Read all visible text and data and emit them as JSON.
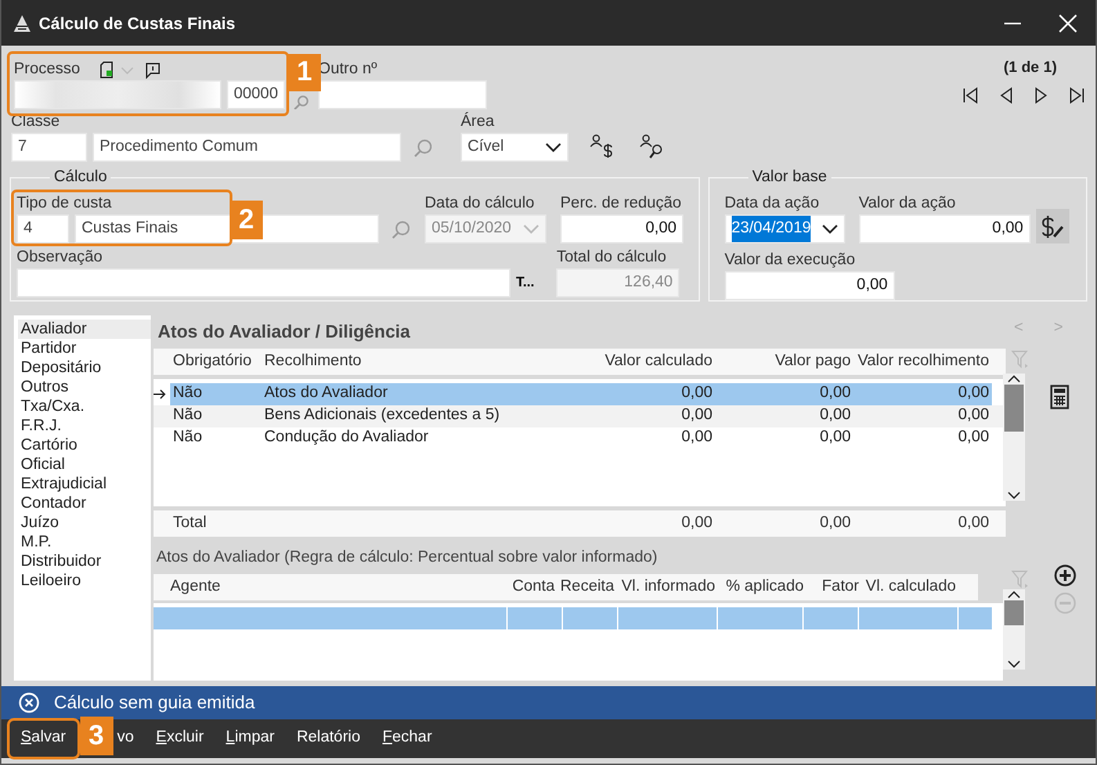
{
  "window": {
    "title": "Cálculo de Custas Finais"
  },
  "processo": {
    "label": "Processo",
    "number": "00000",
    "callout": "1"
  },
  "outro_numero": {
    "label": "Outro nº"
  },
  "pager": {
    "text": "(1 de 1)"
  },
  "classe": {
    "label": "Classe",
    "code": "7",
    "name": "Procedimento Comum"
  },
  "area": {
    "label": "Área",
    "value": "Cível"
  },
  "calculo": {
    "legend": "Cálculo",
    "tipo_custa": {
      "label": "Tipo de custa",
      "code": "4",
      "name": "Custas Finais",
      "callout": "2"
    },
    "data_calculo": {
      "label": "Data do cálculo",
      "value": "05/10/2020",
      "disabled": true
    },
    "perc_reducao": {
      "label": "Perc. de redução",
      "value": "0,00",
      "disabled": false
    },
    "observacao": {
      "label": "Observação",
      "button": "T..."
    },
    "total": {
      "label": "Total do cálculo",
      "value": "126,40",
      "disabled": true
    }
  },
  "valor_base": {
    "legend": "Valor base",
    "data_acao": {
      "label": "Data da ação",
      "value": "23/04/2019",
      "text_selected": true
    },
    "valor_acao": {
      "label": "Valor da ação",
      "value": "0,00"
    },
    "valor_execucao": {
      "label": "Valor da execução",
      "value": "0,00"
    }
  },
  "sidebar": {
    "items": [
      {
        "label": "Avaliador",
        "selected": true
      },
      {
        "label": "Partidor",
        "selected": false
      },
      {
        "label": "Depositário",
        "selected": false
      },
      {
        "label": "Outros",
        "selected": false
      },
      {
        "label": "Txa/Cxa.",
        "selected": false
      },
      {
        "label": "F.R.J.",
        "selected": false
      },
      {
        "label": "Cartório",
        "selected": false
      },
      {
        "label": "Oficial",
        "selected": false
      },
      {
        "label": "Extrajudicial",
        "selected": false
      },
      {
        "label": "Contador",
        "selected": false
      },
      {
        "label": "Juízo",
        "selected": false
      },
      {
        "label": "M.P.",
        "selected": false
      },
      {
        "label": "Distribuidor",
        "selected": false
      },
      {
        "label": "Leiloeiro",
        "selected": false
      }
    ]
  },
  "atos": {
    "title": "Atos do Avaliador / Diligência",
    "nav": [
      "<",
      ">"
    ],
    "columns": [
      "Obrigatório",
      "Recolhimento",
      "Valor calculado",
      "Valor pago",
      "Valor recolhimento"
    ],
    "rows": [
      {
        "cells": [
          "Não",
          "Atos do Avaliador",
          "0,00",
          "0,00",
          "0,00"
        ],
        "selected": true
      },
      {
        "cells": [
          "Não",
          "Bens Adicionais (excedentes a 5)",
          "0,00",
          "0,00",
          "0,00"
        ],
        "selected": false
      },
      {
        "cells": [
          "Não",
          "Condução do Avaliador",
          "0,00",
          "0,00",
          "0,00"
        ],
        "selected": false
      }
    ],
    "total": {
      "label": "Total",
      "values": [
        "0,00",
        "0,00",
        "0,00"
      ]
    }
  },
  "agentes": {
    "caption": "Atos do Avaliador (Regra de cálculo: Percentual sobre valor informado)",
    "columns": [
      "Agente",
      "Conta",
      "Receita",
      "Vl. informado",
      "% aplicado",
      "Fator",
      "Vl. calculado"
    ],
    "rows": [
      {
        "selected": true
      }
    ],
    "remove_disabled": true
  },
  "status_bar": {
    "message": "Cálculo sem guia emitida"
  },
  "buttons": [
    {
      "label": "Salvar",
      "shortcut_underlined": true,
      "callout": "3"
    },
    {
      "label": "vo",
      "shortcut_underlined": false
    },
    {
      "label": "Excluir",
      "shortcut_underlined": true
    },
    {
      "label": "Limpar",
      "shortcut_underlined": true
    },
    {
      "label": "Relatório",
      "shortcut_underlined": false
    },
    {
      "label": "Fechar",
      "shortcut_underlined": true
    }
  ]
}
